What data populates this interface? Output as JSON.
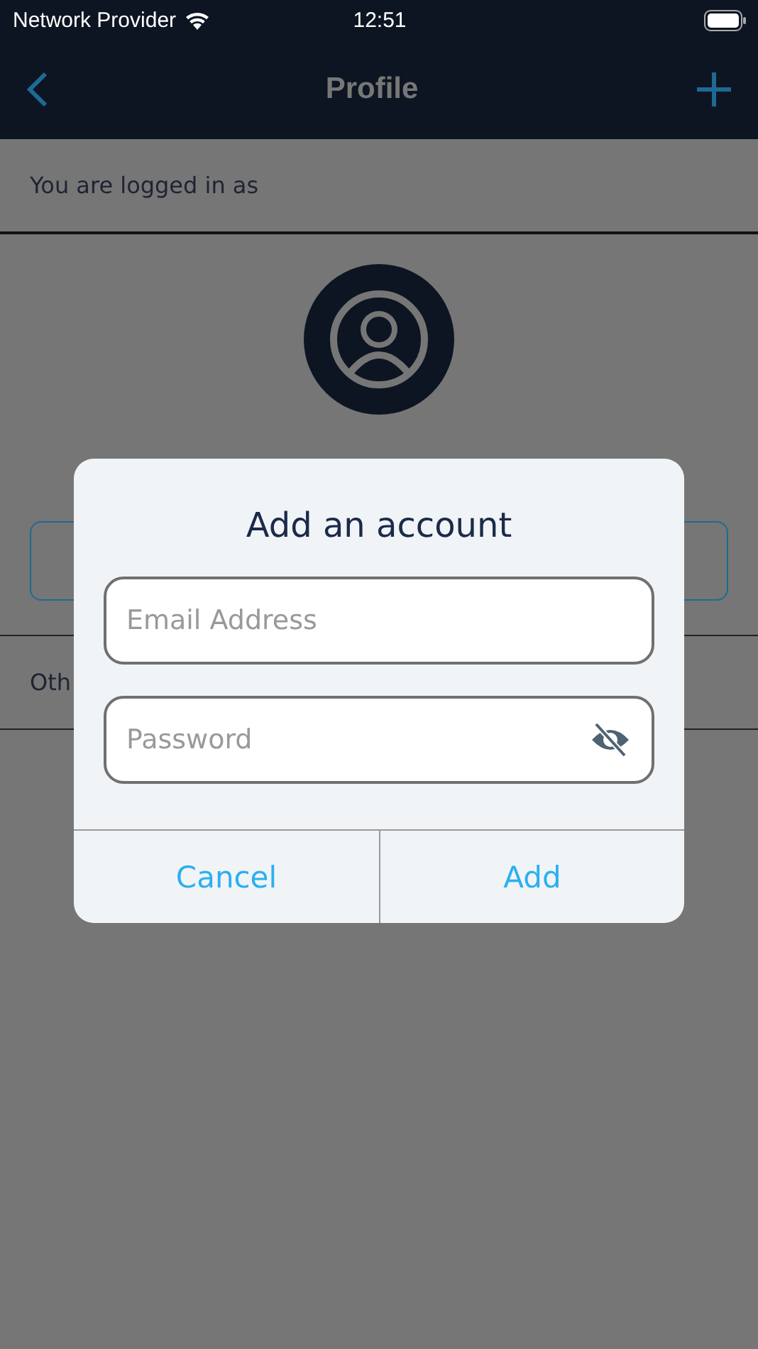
{
  "status_bar": {
    "carrier": "Network Provider",
    "time": "12:51"
  },
  "nav": {
    "title": "Profile"
  },
  "logged_in_header": "You are logged in as",
  "other_header": "Oth",
  "dialog": {
    "title": "Add an account",
    "fields": [
      {
        "kind": "text",
        "placeholder": "Email Address"
      },
      {
        "kind": "password",
        "placeholder": "Password"
      }
    ],
    "buttons": [
      "Cancel",
      "Add"
    ]
  }
}
